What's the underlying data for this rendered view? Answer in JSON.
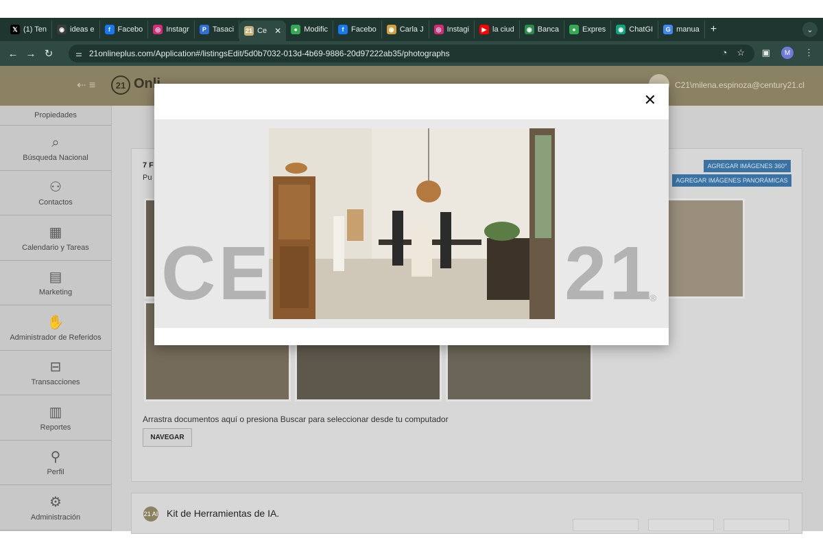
{
  "browser": {
    "tabs": [
      {
        "label": "(1) Ten",
        "icon": "x-logo-icon",
        "color": "#000000",
        "glyph": "𝕏"
      },
      {
        "label": "ideas e",
        "icon": "chatgpt-icon",
        "color": "#3b3b3b",
        "glyph": "◉"
      },
      {
        "label": "Facebo",
        "icon": "facebook-icon",
        "color": "#1877f2",
        "glyph": "f"
      },
      {
        "label": "Instagr",
        "icon": "instagram-icon",
        "color": "#d62976",
        "glyph": "◎"
      },
      {
        "label": "Tasaci",
        "icon": "pinterest-icon",
        "color": "#2f6fd6",
        "glyph": "P"
      },
      {
        "label": "Ce",
        "icon": "century21-icon",
        "color": "#c7b37a",
        "glyph": "21",
        "active": true
      },
      {
        "label": "Modific",
        "icon": "maps-pin-icon",
        "color": "#34a853",
        "glyph": "●"
      },
      {
        "label": "Facebo",
        "icon": "facebook-icon",
        "color": "#1877f2",
        "glyph": "f"
      },
      {
        "label": "Carla J",
        "icon": "app-icon",
        "color": "#d0a040",
        "glyph": "◉"
      },
      {
        "label": "Instagi",
        "icon": "instagram-icon",
        "color": "#d62976",
        "glyph": "◎"
      },
      {
        "label": "la ciud",
        "icon": "youtube-icon",
        "color": "#ff0000",
        "glyph": "▶"
      },
      {
        "label": "Banca",
        "icon": "bank-icon",
        "color": "#2c8c4a",
        "glyph": "◉"
      },
      {
        "label": "Expres",
        "icon": "maps-pin-icon",
        "color": "#34a853",
        "glyph": "●"
      },
      {
        "label": "ChatGI",
        "icon": "chatgpt-icon",
        "color": "#10a37f",
        "glyph": "◉"
      },
      {
        "label": "manua",
        "icon": "google-icon",
        "color": "#4285f4",
        "glyph": "G"
      }
    ],
    "url": "21onlineplus.com/Application#/listingsEdit/5d0b7032-013d-4b69-9886-20d97222ab35/photographs",
    "profile_initial": "M"
  },
  "header": {
    "logo_number": "21",
    "logo_text": "Onli",
    "user_email": "C21\\milena.espinoza@century21.cl"
  },
  "sidebar": {
    "items": [
      {
        "label": "Propiedades",
        "icon": "properties-icon",
        "glyph": ""
      },
      {
        "label": "Búsqueda Nacional",
        "icon": "search-icon",
        "glyph": "⌕"
      },
      {
        "label": "Contactos",
        "icon": "contacts-icon",
        "glyph": "⚇"
      },
      {
        "label": "Calendario y Tareas",
        "icon": "calendar-icon",
        "glyph": "▦"
      },
      {
        "label": "Marketing",
        "icon": "marketing-icon",
        "glyph": "▤"
      },
      {
        "label": "Administrador de Referidos",
        "icon": "handshake-icon",
        "glyph": "✋"
      },
      {
        "label": "Transacciones",
        "icon": "briefcase-icon",
        "glyph": "⊟"
      },
      {
        "label": "Reportes",
        "icon": "bar-chart-icon",
        "glyph": "▥"
      },
      {
        "label": "Perfil",
        "icon": "user-icon",
        "glyph": "⚲"
      },
      {
        "label": "Administración",
        "icon": "gear-icon",
        "glyph": "⚙"
      }
    ]
  },
  "main": {
    "card_title": "7 F",
    "card_subtitle": "Pu",
    "btn_360": "AGREGAR IMÁGENES 360°",
    "btn_panoramic": "AGREGAR IMÁGENES PANORÁMICAS",
    "drop_text": "Arrastra documentos aquí o presiona Buscar para seleccionar desde tu computador",
    "browse_button": "NAVEGAR",
    "ai_kit_badge": "21 AI",
    "ai_kit_title": "Kit de Herramientas de IA."
  },
  "modal": {
    "close_glyph": "✕",
    "watermark": "CENTURY 21",
    "watermark_mark": "®"
  }
}
